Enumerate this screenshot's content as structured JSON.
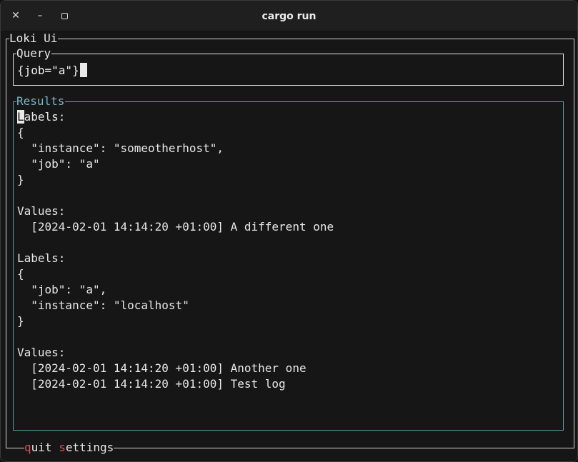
{
  "window": {
    "title": "cargo run"
  },
  "app": {
    "title": "Loki Ui"
  },
  "query": {
    "title": "Query",
    "value": "{job=\"a\"}"
  },
  "results": {
    "title": "Results",
    "lines": [
      "Labels:",
      "{",
      "  \"instance\": \"someotherhost\",",
      "  \"job\": \"a\"",
      "}",
      "",
      "Values:",
      "  [2024-02-01 14:14:20 +01:00] A different one",
      "",
      "Labels:",
      "{",
      "  \"job\": \"a\",",
      "  \"instance\": \"localhost\"",
      "}",
      "",
      "Values:",
      "  [2024-02-01 14:14:20 +01:00] Another one",
      "  [2024-02-01 14:14:20 +01:00] Test log"
    ]
  },
  "footer": {
    "quit": {
      "key": "q",
      "rest": "uit"
    },
    "settings": {
      "key": "s",
      "rest": "ettings"
    }
  },
  "colors": {
    "results_border": "#5f9aa8",
    "hotkey": "#d0505a",
    "background": "#161616"
  }
}
